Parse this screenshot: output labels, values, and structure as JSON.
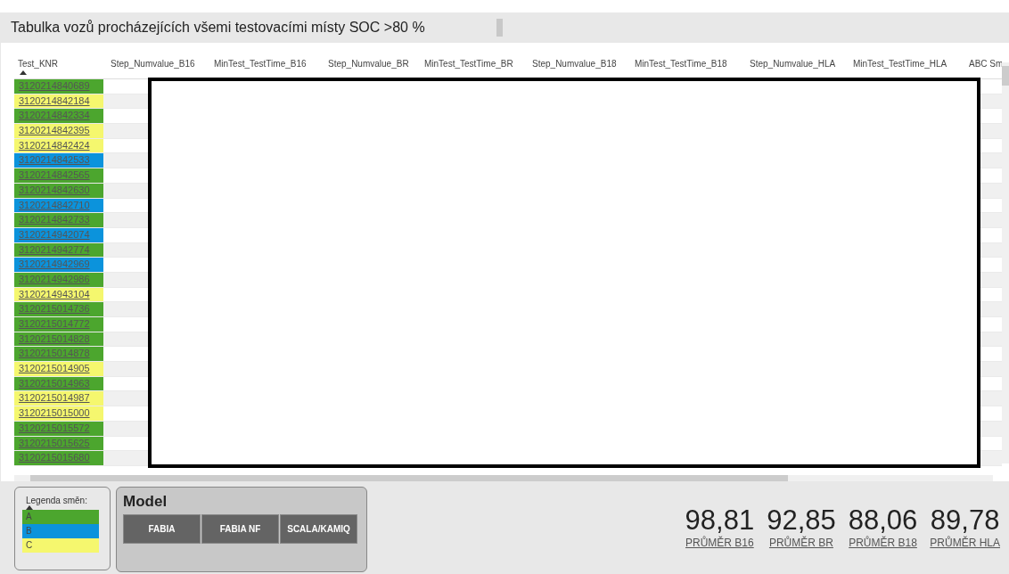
{
  "title": "Tabulka vozů procházejících všemi testovacími místy SOC >80 %",
  "table": {
    "columns": [
      {
        "label": "Test_KNR",
        "sorted": true
      },
      {
        "label": "Step_Numvalue_B16",
        "sorted": false
      },
      {
        "label": "MinTest_TestTime_B16",
        "sorted": false
      },
      {
        "label": "Step_Numvalue_BR",
        "sorted": false
      },
      {
        "label": "MinTest_TestTime_BR",
        "sorted": false
      },
      {
        "label": "Step_Numvalue_B18",
        "sorted": false
      },
      {
        "label": "MinTest_TestTime_B18",
        "sorted": false
      },
      {
        "label": "Step_Numvalue_HLA",
        "sorted": false
      },
      {
        "label": "MinTest_TestTime_HLA",
        "sorted": false
      },
      {
        "label": "ABC Sm",
        "sorted": false
      }
    ],
    "rows": [
      {
        "knr": "3120214840689",
        "color": "#4ca62e"
      },
      {
        "knr": "3120214842184",
        "color": "#f5f76e"
      },
      {
        "knr": "3120214842334",
        "color": "#4ca62e"
      },
      {
        "knr": "3120214842395",
        "color": "#f5f76e"
      },
      {
        "knr": "3120214842424",
        "color": "#f5f76e"
      },
      {
        "knr": "3120214842533",
        "color": "#0b93dc"
      },
      {
        "knr": "3120214842565",
        "color": "#4ca62e"
      },
      {
        "knr": "3120214842630",
        "color": "#4ca62e"
      },
      {
        "knr": "3120214842710",
        "color": "#0b93dc"
      },
      {
        "knr": "3120214842733",
        "color": "#4ca62e"
      },
      {
        "knr": "3120214942074",
        "color": "#0b93dc"
      },
      {
        "knr": "3120214942774",
        "color": "#4ca62e"
      },
      {
        "knr": "3120214942969",
        "color": "#0b93dc"
      },
      {
        "knr": "3120214942986",
        "color": "#4ca62e"
      },
      {
        "knr": "3120214943104",
        "color": "#f5f76e"
      },
      {
        "knr": "3120215014736",
        "color": "#4ca62e"
      },
      {
        "knr": "3120215014772",
        "color": "#4ca62e"
      },
      {
        "knr": "3120215014828",
        "color": "#4ca62e"
      },
      {
        "knr": "3120215014878",
        "color": "#4ca62e"
      },
      {
        "knr": "3120215014905",
        "color": "#f5f76e"
      },
      {
        "knr": "3120215014963",
        "color": "#4ca62e"
      },
      {
        "knr": "3120215014987",
        "color": "#f5f76e"
      },
      {
        "knr": "3120215015000",
        "color": "#f5f76e"
      },
      {
        "knr": "3120215015572",
        "color": "#4ca62e"
      },
      {
        "knr": "3120215015625",
        "color": "#4ca62e"
      },
      {
        "knr": "3120215015680",
        "color": "#4ca62e"
      }
    ]
  },
  "legend": {
    "title": "Legenda směn:",
    "items": [
      {
        "label": "A",
        "color": "#4ca62e"
      },
      {
        "label": "B",
        "color": "#0b93dc"
      },
      {
        "label": "C",
        "color": "#f5f76e"
      }
    ]
  },
  "model": {
    "title": "Model",
    "buttons": [
      {
        "label": "FABIA"
      },
      {
        "label": "FABIA NF"
      },
      {
        "label": "SCALA/KAMIQ"
      }
    ]
  },
  "stats": [
    {
      "value": "98,81",
      "label": "PRŮMĚR B16"
    },
    {
      "value": "92,85",
      "label": "PRŮMĚR BR"
    },
    {
      "value": "88,06",
      "label": "PRŮMĚR B18"
    },
    {
      "value": "89,78",
      "label": "PRŮMĚR HLA"
    }
  ]
}
